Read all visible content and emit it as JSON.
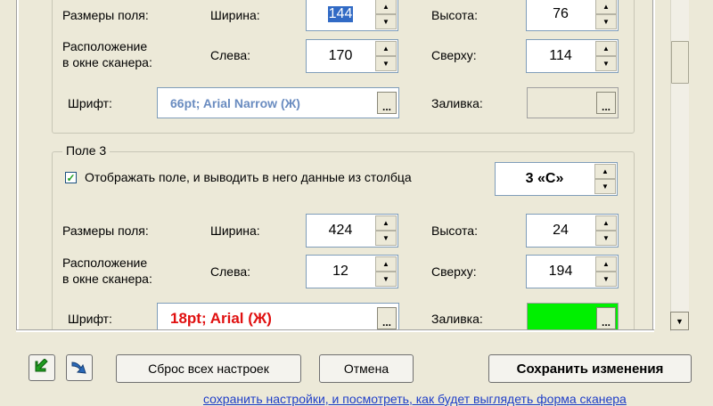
{
  "field_top": {
    "size_label": "Размеры поля:",
    "width_label": "Ширина:",
    "width_value": "144",
    "height_label": "Высота:",
    "height_value": "76",
    "position_label_line1": "Расположение",
    "position_label_line2": "в окне сканера:",
    "left_label": "Слева:",
    "left_value": "170",
    "top_label": "Сверху:",
    "top_value": "114",
    "font_label": "Шрифт:",
    "font_value": "66pt; Arial Narrow (Ж)",
    "fill_label": "Заливка:",
    "browse_label": "...",
    "font_color": "#6a8cc0"
  },
  "field3": {
    "title": "Поле 3",
    "checkbox_label": "Отображать поле, и выводить в него данные из столбца",
    "checkbox_checked": true,
    "column_value": "3 «C»",
    "size_label": "Размеры поля:",
    "width_label": "Ширина:",
    "width_value": "424",
    "height_label": "Высота:",
    "height_value": "24",
    "position_label_line1": "Расположение",
    "position_label_line2": "в окне сканера:",
    "left_label": "Слева:",
    "left_value": "12",
    "top_label": "Сверху:",
    "top_value": "194",
    "font_label": "Шрифт:",
    "font_value": "18pt; Arial (Ж)",
    "fill_label": "Заливка:",
    "browse_label": "...",
    "font_color": "#e01010",
    "fill_color": "#00f000"
  },
  "spin_up_glyph": "▲",
  "spin_down_glyph": "▼",
  "scroll_down_glyph": "▼",
  "bottom": {
    "reset_label": "Сброс всех настроек",
    "cancel_label": "Отмена",
    "save_label": "Сохранить изменения",
    "footer_text": "сохранить настройки, и посмотреть, как будет выглядеть форма сканера"
  },
  "icons": {
    "import": "green-arrow-icon",
    "export": "blue-arrow-icon"
  }
}
